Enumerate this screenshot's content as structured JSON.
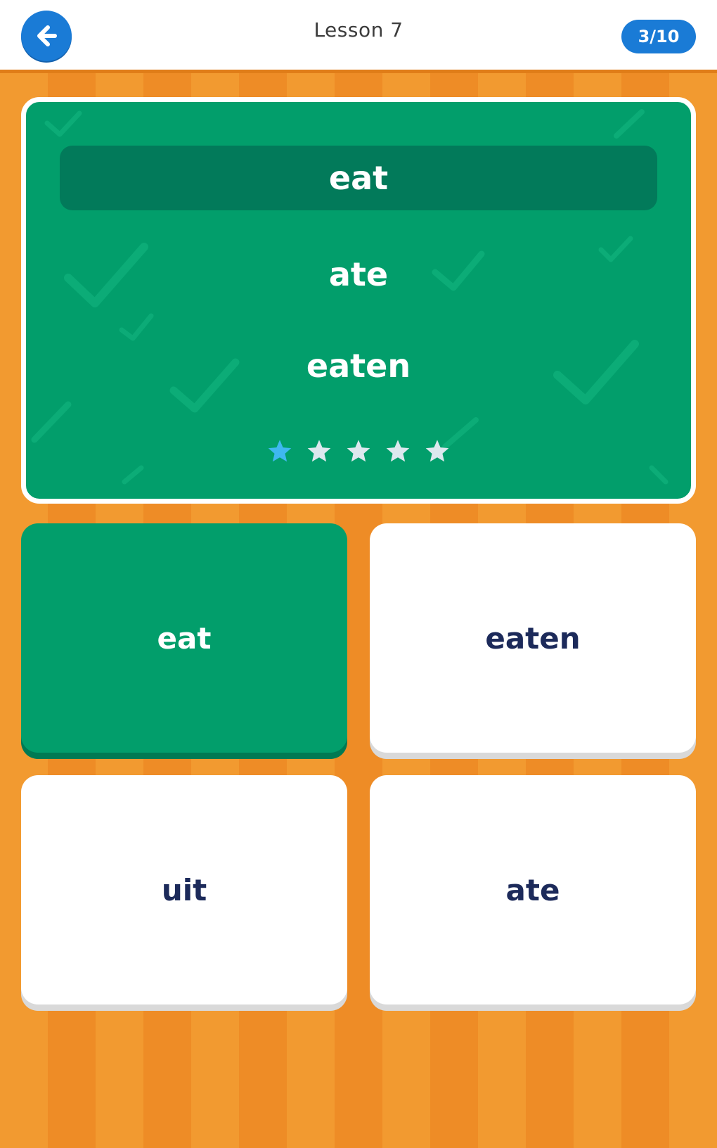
{
  "header": {
    "back_icon": "arrow-left-icon",
    "title": "Lesson 7",
    "progress": "3/10",
    "back_color": "#1a7bd6"
  },
  "prompt": {
    "base_word": "eat",
    "forms": [
      "ate",
      "eaten"
    ],
    "card_color": "#029e6b",
    "rating": {
      "filled": 1,
      "total": 5,
      "filled_color": "#3fb8f0",
      "empty_color": "#dde8ee"
    }
  },
  "options": [
    {
      "label": "eat",
      "selected": true
    },
    {
      "label": "eaten",
      "selected": false
    },
    {
      "label": "uit",
      "selected": false
    },
    {
      "label": "ate",
      "selected": false
    }
  ],
  "colors": {
    "background": "#ef902a",
    "accent": "#1a7bd6",
    "correct": "#029e6b",
    "text_dark": "#1c2a5a"
  }
}
